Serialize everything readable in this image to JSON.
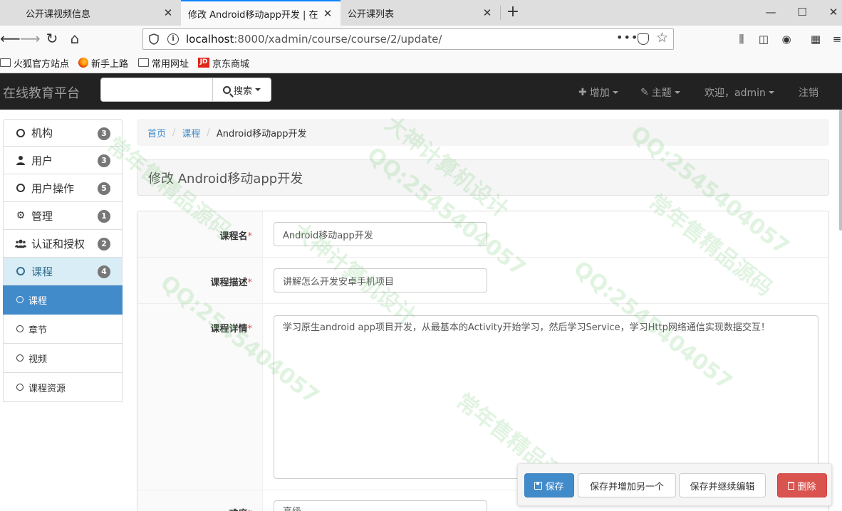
{
  "browser": {
    "tabs": [
      {
        "title": "公开课视频信息",
        "active": false
      },
      {
        "title": "修改 Android移动app开发 | 在",
        "active": true
      },
      {
        "title": "公开课列表",
        "active": false
      }
    ],
    "new_tab_label": "+",
    "url_host": "localhost",
    "url_path": ":8000/xadmin/course/course/2/update/",
    "page_actions_label": "•••",
    "bookmarks": [
      {
        "label": "火狐官方站点",
        "icon": "folder-icon"
      },
      {
        "label": "新手上路",
        "icon": "firefox-icon"
      },
      {
        "label": "常用网址",
        "icon": "folder-icon"
      },
      {
        "label": "京东商城",
        "icon": "jd-icon"
      }
    ],
    "jd_icon_text": "JD"
  },
  "header": {
    "brand": "在线教育平台",
    "search_button": "搜索",
    "search_placeholder": "",
    "nav": {
      "add": "增加",
      "theme": "主题",
      "welcome": "欢迎，admin",
      "logout": "注销"
    }
  },
  "sidebar": {
    "groups": [
      {
        "label": "机构",
        "count": "3",
        "icon": "circle-icon"
      },
      {
        "label": "用户",
        "count": "3",
        "icon": "user-icon"
      },
      {
        "label": "用户操作",
        "count": "5",
        "icon": "circle-icon"
      },
      {
        "label": "管理",
        "count": "1",
        "icon": "gear-icon"
      },
      {
        "label": "认证和授权",
        "count": "2",
        "icon": "users-icon"
      },
      {
        "label": "课程",
        "count": "4",
        "icon": "circle-icon"
      }
    ],
    "sub_items": [
      {
        "label": "课程",
        "active": true
      },
      {
        "label": "章节",
        "active": false
      },
      {
        "label": "视频",
        "active": false
      },
      {
        "label": "课程资源",
        "active": false
      }
    ]
  },
  "breadcrumb": {
    "home": "首页",
    "section": "课程",
    "current": "Android移动app开发",
    "separator": "/"
  },
  "page_title": "修改 Android移动app开发",
  "form": {
    "name_label": "课程名",
    "name_value": "Android移动app开发",
    "desc_label": "课程描述",
    "desc_value": "讲解怎么开发安卓手机项目",
    "detail_label": "课程详情",
    "detail_value": "学习原生android app项目开发，从最基本的Activity开始学习，然后学习Service，学习Http网络通信实现数据交互！",
    "degree_label": "难度",
    "degree_value": "高级",
    "required_mark": "*"
  },
  "actions": {
    "save": "保存",
    "save_add": "保存并增加另一个",
    "save_continue": "保存并继续编辑",
    "delete": "删除"
  },
  "watermark": {
    "qq": "QQ:2545404057",
    "design": "大神计算机设计",
    "source": "常年售精品源码"
  },
  "colors": {
    "primary": "#428bca",
    "danger": "#d9534f",
    "navbar": "#222222",
    "active_group": "#d9edf7"
  }
}
